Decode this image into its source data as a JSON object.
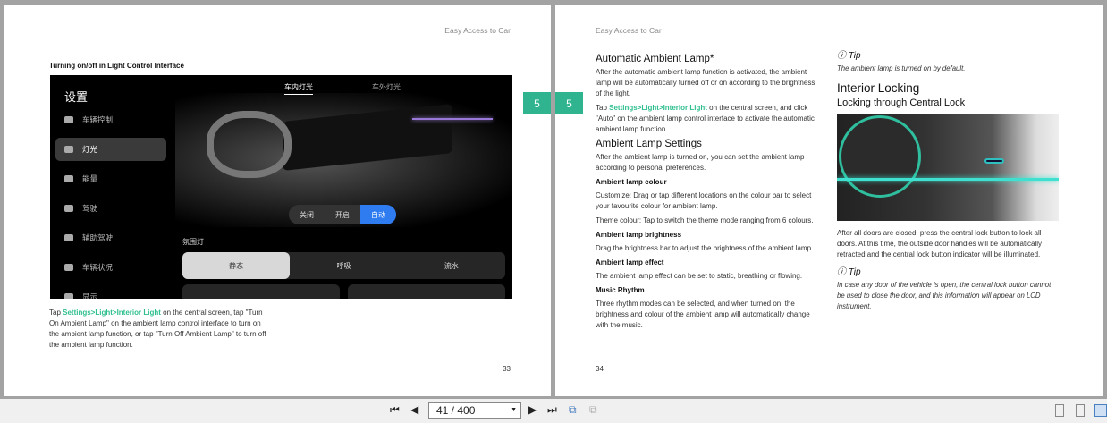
{
  "left_page": {
    "header": "Easy Access to Car",
    "caption": "Turning on/off in Light Control Interface",
    "chapter_tab": "5",
    "screen": {
      "title": "设置",
      "nav": [
        "车辆控制",
        "灯光",
        "能量",
        "驾驶",
        "辅助驾驶",
        "车辆状况",
        "显示"
      ],
      "tabs": [
        "车内灯光",
        "车外灯光"
      ],
      "mode_buttons": [
        "关闭",
        "开启",
        "自动"
      ],
      "section_label": "氛围灯",
      "effects": [
        "静态",
        "呼吸",
        "流水"
      ]
    },
    "para_pre": "Tap ",
    "para_link": "Settings>Light>Interior Light",
    "para_post": " on the central screen, tap \"Turn On Ambient Lamp\" on the ambient lamp control interface to turn on the ambient lamp function, or tap \"Turn Off Ambient Lamp\" to turn off the ambient lamp function.",
    "page_number": "33"
  },
  "right_page": {
    "header": "Easy Access to Car",
    "chapter_tab": "5",
    "h_auto": "Automatic Ambient Lamp*",
    "p_auto1": "After the automatic ambient lamp function is activated, the ambient lamp will be automatically turned off or on according to the brightness of the light.",
    "p_auto2_pre": "Tap ",
    "p_auto2_link": "Settings>Light>Interior Light",
    "p_auto2_post": " on the central screen, and click \"Auto\" on the ambient lamp control interface to activate the automatic ambient lamp function.",
    "h_settings": "Ambient Lamp Settings",
    "p_settings": "After the ambient lamp is turned on, you can set the ambient lamp according to personal preferences.",
    "h_colour": "Ambient lamp colour",
    "p_colour1": "Customize: Drag or tap different locations on the colour bar to select your favourite colour for ambient lamp.",
    "p_colour2": "Theme colour: Tap to switch the theme mode ranging from 6 colours.",
    "h_bright": "Ambient lamp brightness",
    "p_bright": "Drag the brightness bar to adjust the brightness of the ambient lamp.",
    "h_effect": "Ambient lamp effect",
    "p_effect": "The ambient lamp effect can be set to static, breathing or flowing.",
    "h_music": "Music Rhythm",
    "p_music": "Three rhythm modes can be selected, and when turned on, the brightness and colour of the ambient lamp will automatically change with the music.",
    "tip1_title": "Tip",
    "tip1": "The ambient lamp is turned on by default.",
    "h_locking": "Interior Locking",
    "h_central": "Locking through Central Lock",
    "p_lock": "After all doors are closed, press the central lock button to lock all doors. At this time, the outside door handles will be automatically retracted and the central lock button indicator will be illuminated.",
    "tip2_title": "Tip",
    "tip2": "In case any door of the vehicle is open, the central lock button cannot be used to close the door, and this information will appear on LCD instrument.",
    "page_number": "34"
  },
  "toolbar": {
    "page_field": "41 / 400"
  },
  "colors": {
    "accent": "#2fb48f",
    "link": "#2fbf8f",
    "auto_button": "#2f7cf0"
  }
}
